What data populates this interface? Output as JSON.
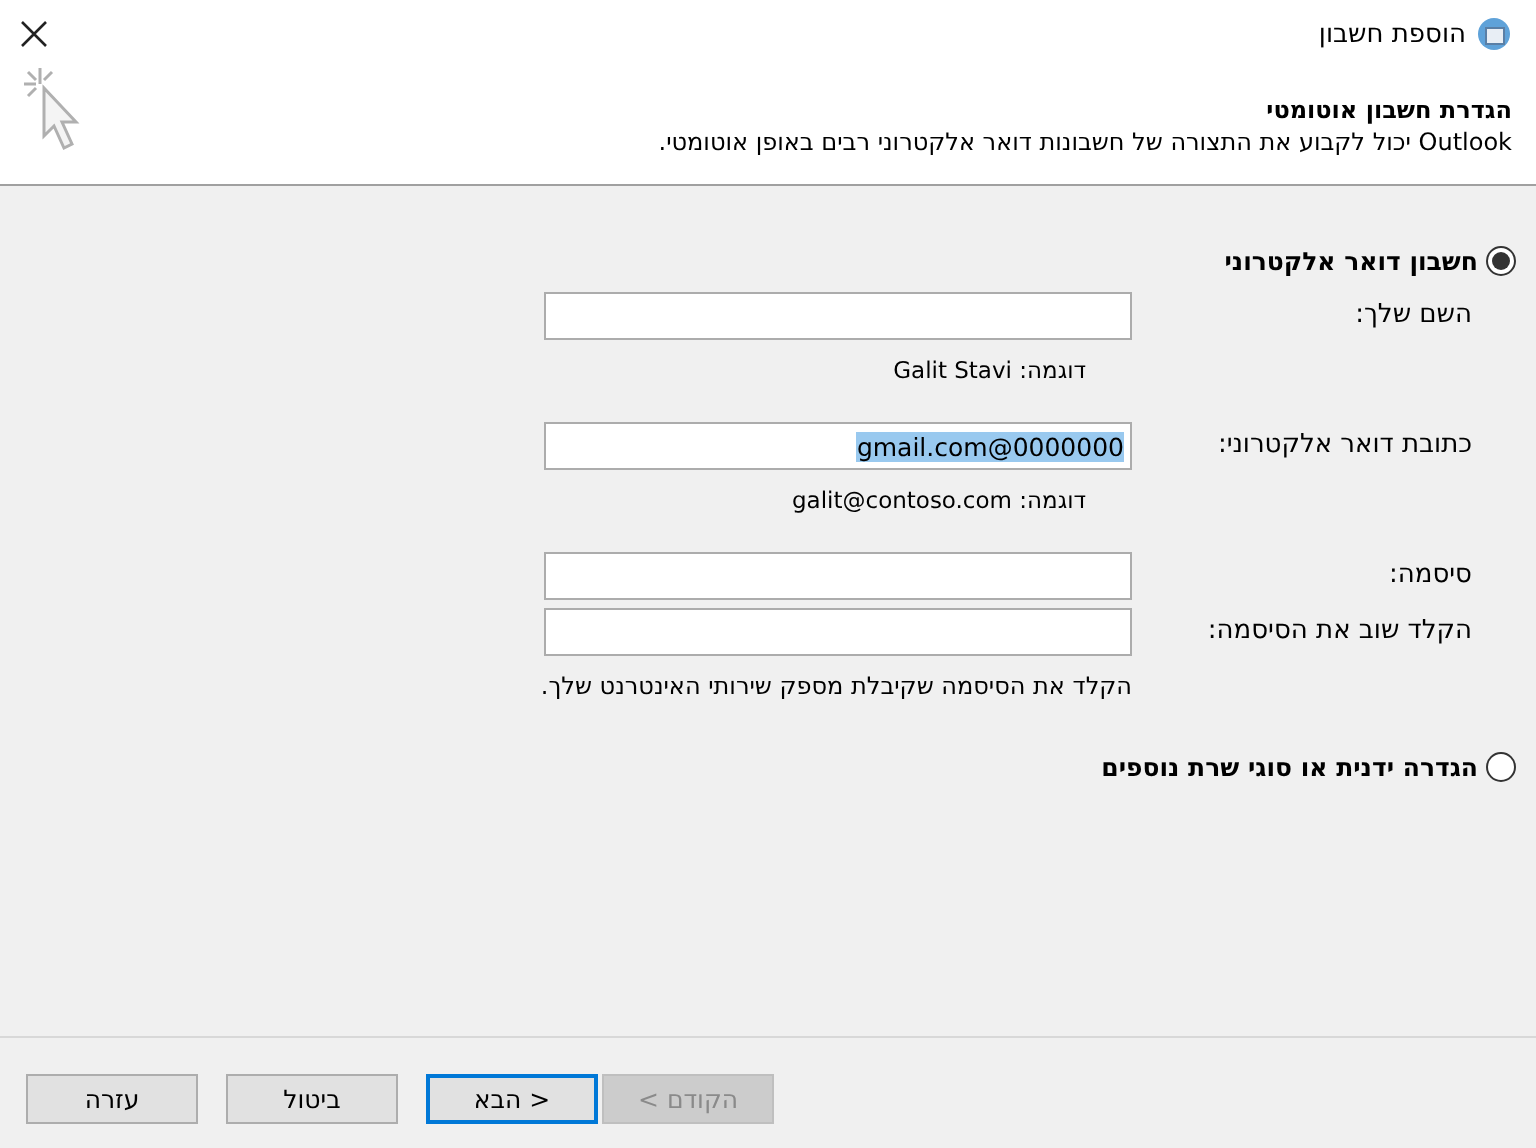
{
  "window": {
    "title": "הוספת חשבון"
  },
  "header": {
    "title": "הגדרת חשבון אוטומטי",
    "description": "Outlook יכול לקבוע את התצורה של חשבונות דואר אלקטרוני רבים באופן אוטומטי."
  },
  "options": [
    {
      "label": "חשבון דואר אלקטרוני",
      "selected": true,
      "fields": [
        {
          "label": "השם שלך:",
          "example": "דוגמה: Galit Stavi"
        },
        {
          "label": "כתובת דואר אלקטרוני:",
          "value": "gmail.com@0000000",
          "value_selected": true,
          "example": "דוגמה: galit@contoso.com"
        },
        {
          "label": "סיסמה:"
        },
        {
          "label": "הקלד שוב את הסיסמה:"
        }
      ],
      "note": "הקלד את הסיסמה שקיבלת מספק שירותי האינטרנט שלך."
    },
    {
      "label": "הגדרה ידנית או סוגי שרת נוספים",
      "selected": false
    }
  ],
  "buttons": [
    {
      "label": "< הקודם",
      "disabled": true,
      "default": false
    },
    {
      "label": "הבא >",
      "disabled": false,
      "default": true
    },
    {
      "label": "ביטול",
      "disabled": false,
      "default": false
    },
    {
      "label": "עזרה",
      "disabled": false,
      "default": false
    }
  ]
}
